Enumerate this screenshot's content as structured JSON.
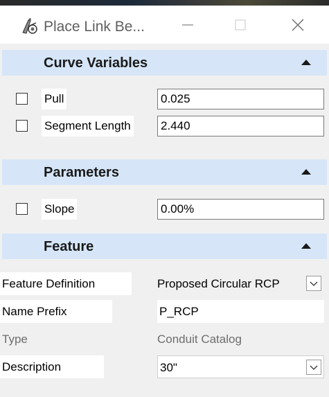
{
  "window": {
    "title": "Place Link Be...",
    "icons": {
      "app": "pencil-compass-icon",
      "minimize": "minimize-icon",
      "maximize": "maximize-icon",
      "close": "close-icon"
    }
  },
  "sections": {
    "curve_variables": {
      "title": "Curve Variables",
      "rows": [
        {
          "label": "Pull",
          "value": "0.025",
          "checked": false
        },
        {
          "label": "Segment Length",
          "value": "2.440",
          "checked": false
        }
      ]
    },
    "parameters": {
      "title": "Parameters",
      "rows": [
        {
          "label": "Slope",
          "value": "0.00%",
          "checked": false
        }
      ]
    },
    "feature": {
      "title": "Feature",
      "rows": [
        {
          "label": "Feature Definition",
          "value": "Proposed Circular RCP",
          "dropdown": true
        },
        {
          "label": "Name Prefix",
          "value": "P_RCP"
        },
        {
          "label": "Type",
          "value": "Conduit Catalog",
          "disabled": true
        },
        {
          "label": "Description",
          "value": "30\"",
          "dropdown": true
        }
      ]
    }
  },
  "colors": {
    "section_header": "#d6e6f8",
    "panel_bg": "#f0f0f0",
    "disabled_text": "#6d6d6d"
  }
}
